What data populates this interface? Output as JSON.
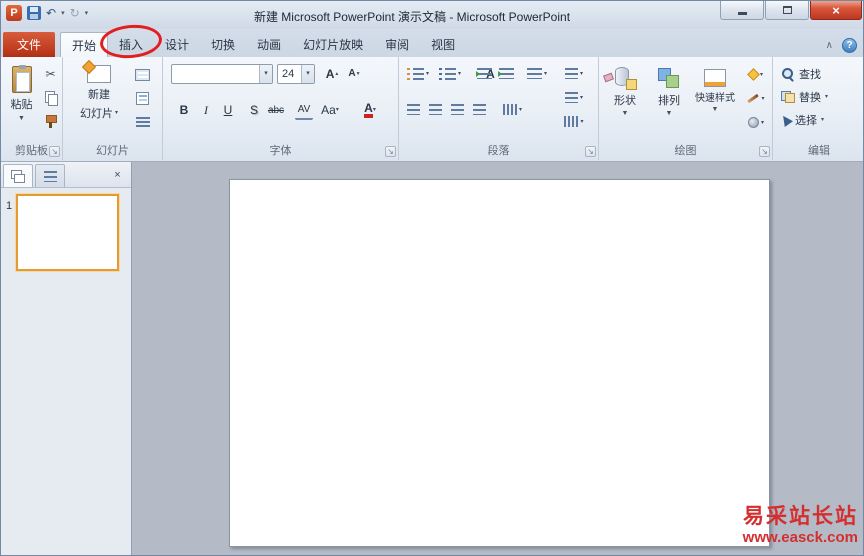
{
  "window": {
    "title": "新建 Microsoft PowerPoint 演示文稿 - Microsoft PowerPoint"
  },
  "icons": {
    "app": "P",
    "undo": "↶",
    "redo": "↻",
    "dd_small": "▾",
    "dd": "▼",
    "cut": "✂",
    "close": "×",
    "collapse": "∧",
    "help": "?",
    "launcher": "↘"
  },
  "tabs": {
    "file": "文件",
    "items": [
      "开始",
      "插入",
      "设计",
      "切换",
      "动画",
      "幻灯片放映",
      "审阅",
      "视图"
    ]
  },
  "ribbon": {
    "clipboard": {
      "label": "剪贴板",
      "paste": "粘贴"
    },
    "slides": {
      "label": "幻灯片",
      "new1": "新建",
      "new2": "幻灯片"
    },
    "font": {
      "label": "字体",
      "font_name": "",
      "size": "24",
      "grow": "A",
      "shrink": "A",
      "clear": "A",
      "bold": "B",
      "italic": "I",
      "underline": "U",
      "shadow": "S",
      "strike": "abc",
      "spacing": "AV",
      "case": "Aa",
      "color": "A"
    },
    "paragraph": {
      "label": "段落"
    },
    "drawing": {
      "label": "绘图",
      "shapes": "形状",
      "arrange": "排列",
      "styles": "快速样式"
    },
    "editing": {
      "label": "编辑",
      "find": "查找",
      "replace": "替换",
      "select": "选择"
    }
  },
  "panel": {
    "slide_number": "1"
  },
  "watermark": {
    "name": "易采站长站",
    "url": "www.easck.com"
  },
  "colors": {
    "file_tab": "#c13c20",
    "annotation": "#e01f1f",
    "watermark": "#d42f2f",
    "close_button": "#bd3823"
  }
}
